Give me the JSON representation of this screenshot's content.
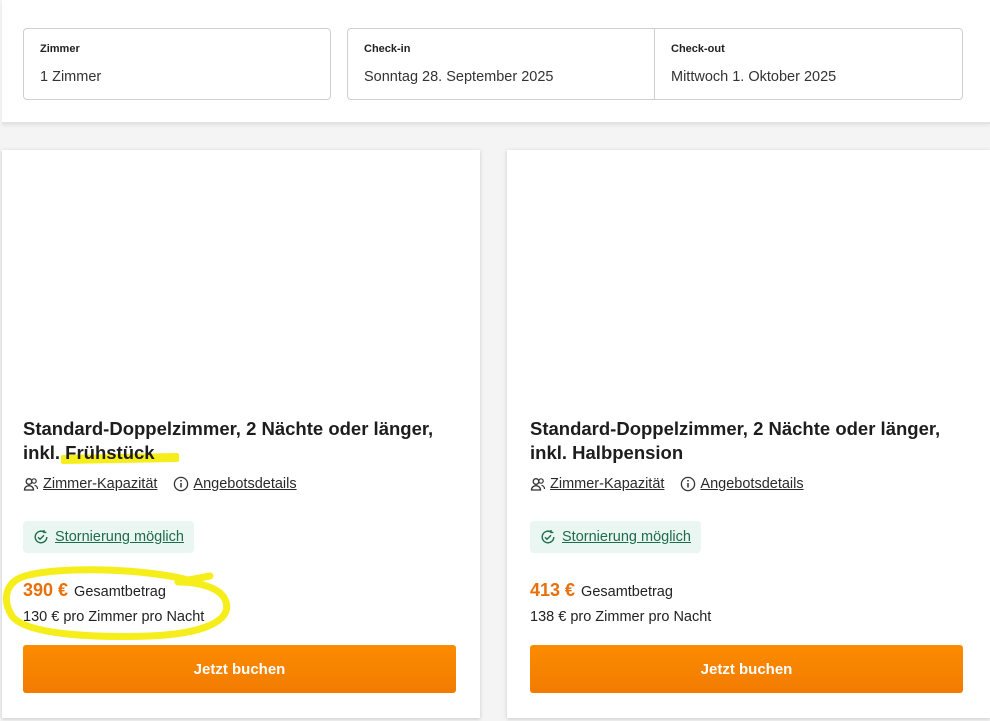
{
  "search": {
    "rooms": {
      "label": "Zimmer",
      "value": "1 Zimmer"
    },
    "checkin": {
      "label": "Check-in",
      "value": "Sonntag 28. September 2025"
    },
    "checkout": {
      "label": "Check-out",
      "value": "Mittwoch 1. Oktober 2025"
    }
  },
  "offers": [
    {
      "title_prefix": "Standard-Doppelzimmer, 2 Nächte oder länger, inkl. ",
      "title_highlight": "Frühstück",
      "capacity_link": "Zimmer-Kapazität",
      "details_link": "Angebotsdetails",
      "cancellation": "Stornierung möglich",
      "price": "390 €",
      "price_label": "Gesamtbetrag",
      "per_night": "130 € pro Zimmer pro Nacht",
      "book_label": "Jetzt buchen"
    },
    {
      "title": "Standard-Doppelzimmer, 2 Nächte oder länger, inkl. Halbpension",
      "capacity_link": "Zimmer-Kapazität",
      "details_link": "Angebotsdetails",
      "cancellation": "Stornierung möglich",
      "price": "413 €",
      "price_label": "Gesamtbetrag",
      "per_night": "138 € pro Zimmer pro Nacht",
      "book_label": "Jetzt buchen"
    }
  ],
  "colors": {
    "accent": "#f68200",
    "price": "#e8700a",
    "highlight": "#f6ee1b",
    "badge_bg": "#eaf6f1"
  }
}
